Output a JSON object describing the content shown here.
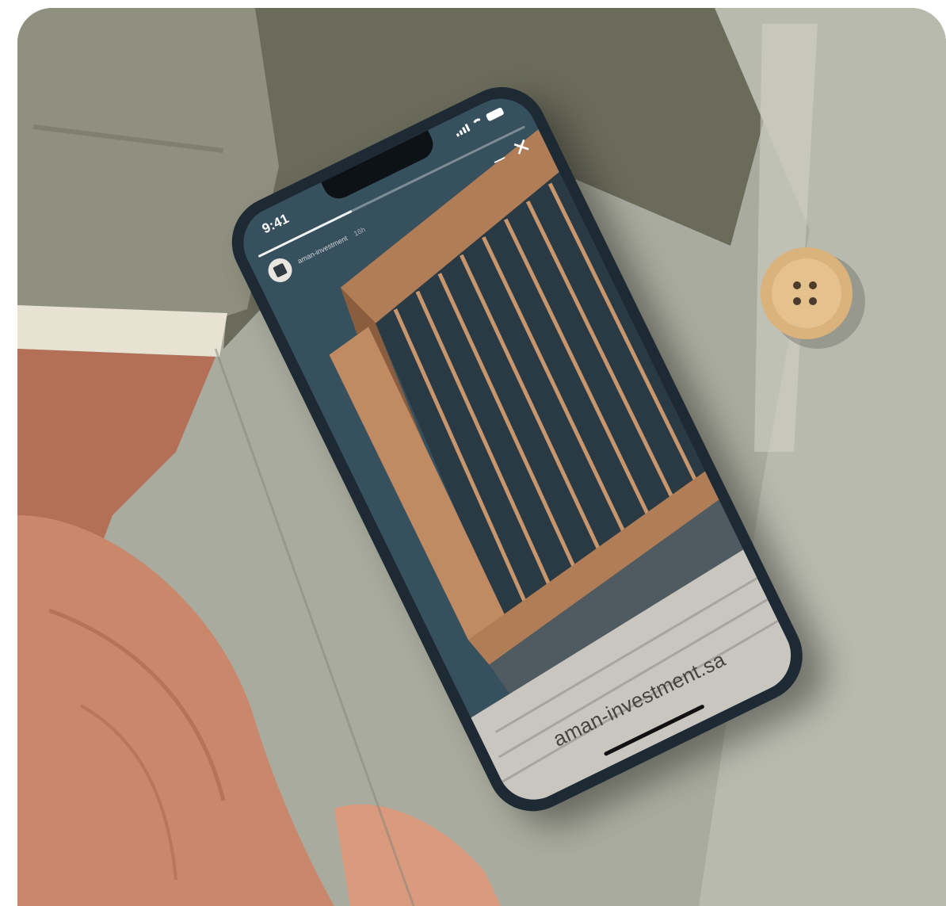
{
  "photo": {
    "subject": "smartphone-in-shirt-pocket",
    "colors": {
      "shirt": "#a9ab9e",
      "shirt_shadow": "#6f7165",
      "sleeve": "#8f907f",
      "cuff": "#e8e2d3",
      "skin": "#c9876c",
      "button": "#d9b27c"
    }
  },
  "phone": {
    "status_bar": {
      "time": "9:41",
      "icons": [
        "signal-icon",
        "wifi-icon",
        "battery-icon"
      ]
    },
    "story": {
      "account": "aman-investment",
      "age": "16h",
      "progress": 0.35,
      "controls": {
        "minimize": "–",
        "close": "✕"
      },
      "url": "aman-investment.sa",
      "colors": {
        "sky": "#37505e",
        "wood": "#b07d57",
        "glass": "#2a3a44",
        "pavement": "#c9c6bf"
      }
    }
  }
}
